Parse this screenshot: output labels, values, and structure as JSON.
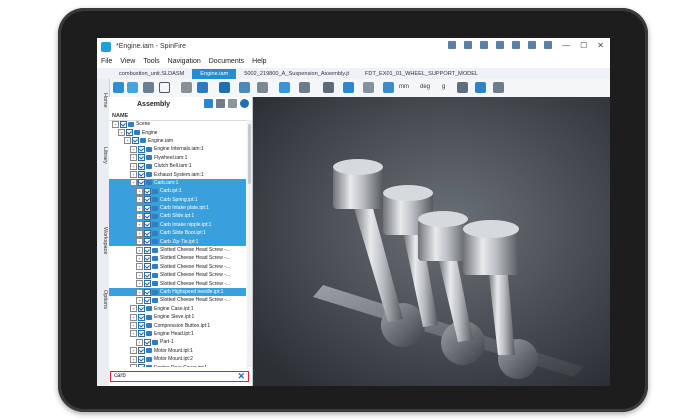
{
  "window": {
    "title": "*Engine.iam - SpinFire"
  },
  "menu": [
    "File",
    "View",
    "Tools",
    "Navigation",
    "Documents",
    "Help"
  ],
  "tabs": [
    {
      "label": "combustion_unit.SLDASM",
      "active": false
    },
    {
      "label": "Engine.iam",
      "active": true
    },
    {
      "label": "5002_219800_A_Suspension_Assembly.jt",
      "active": false
    },
    {
      "label": "FDT_EX01_01_WHEEL_SUPPORT_MODEL",
      "active": false
    }
  ],
  "toolbar": {
    "units_mm": "mm",
    "units_deg": "deg",
    "units_g": "g"
  },
  "side_tabs": [
    "Home",
    "Library",
    "Workspace",
    "Options"
  ],
  "panel": {
    "title": "Assembly",
    "column_name": "NAME"
  },
  "tree": [
    {
      "label": "Scene",
      "indent": 0,
      "sel": false
    },
    {
      "label": "Engine",
      "indent": 1,
      "sel": false
    },
    {
      "label": "Engine.iam",
      "indent": 2,
      "sel": false
    },
    {
      "label": "Engine Internals.iam:1",
      "indent": 3,
      "sel": false
    },
    {
      "label": "Flywheel.iam:1",
      "indent": 3,
      "sel": false
    },
    {
      "label": "Clutch Bell.iam:1",
      "indent": 3,
      "sel": false
    },
    {
      "label": "Exhaust System.iam:1",
      "indent": 3,
      "sel": false
    },
    {
      "label": "Carb.iam:1",
      "indent": 3,
      "sel": true
    },
    {
      "label": "Carb.ipt:1",
      "indent": 4,
      "sel": true
    },
    {
      "label": "Carb Spring.ipt:1",
      "indent": 4,
      "sel": true
    },
    {
      "label": "Carb Intake plate.ipt:1",
      "indent": 4,
      "sel": true
    },
    {
      "label": "Carb Slide.ipt:1",
      "indent": 4,
      "sel": true
    },
    {
      "label": "Carb Intake nipple.ipt:1",
      "indent": 4,
      "sel": true
    },
    {
      "label": "Carb Slide Boot.ipt:1",
      "indent": 4,
      "sel": true
    },
    {
      "label": "Carb Zip-Tie.ipt:1",
      "indent": 4,
      "sel": true
    },
    {
      "label": "Slotted Cheese Head Screw -...",
      "indent": 4,
      "sel": false
    },
    {
      "label": "Slotted Cheese Head Screw -...",
      "indent": 4,
      "sel": false
    },
    {
      "label": "Slotted Cheese Head Screw -...",
      "indent": 4,
      "sel": false
    },
    {
      "label": "Slotted Cheese Head Screw -...",
      "indent": 4,
      "sel": false
    },
    {
      "label": "Slotted Cheese Head Screw -...",
      "indent": 4,
      "sel": false
    },
    {
      "label": "Carb Highspeed needle.ipt:1",
      "indent": 4,
      "sel": true
    },
    {
      "label": "Slotted Cheese Head Screw -...",
      "indent": 4,
      "sel": false
    },
    {
      "label": "Engine Case.ipt:1",
      "indent": 3,
      "sel": false
    },
    {
      "label": "Engine Sleve.ipt:1",
      "indent": 3,
      "sel": false
    },
    {
      "label": "Compression Button.ipt:1",
      "indent": 3,
      "sel": false
    },
    {
      "label": "Engine Head.ipt:1",
      "indent": 3,
      "sel": false
    },
    {
      "label": "Part-1",
      "indent": 4,
      "sel": false
    },
    {
      "label": "Motor Mount.ipt:1",
      "indent": 3,
      "sel": false
    },
    {
      "label": "Motor Mount.ipt:2",
      "indent": 3,
      "sel": false
    },
    {
      "label": "Engine Rear Cover.ipt:1",
      "indent": 3,
      "sel": false
    }
  ],
  "search": {
    "value": "carb"
  }
}
